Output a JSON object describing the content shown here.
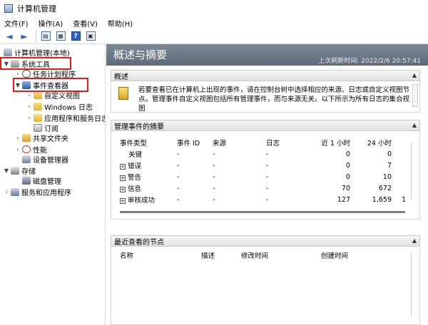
{
  "window": {
    "title": "计算机管理"
  },
  "menu": [
    "文件(F)",
    "操作(A)",
    "查看(V)",
    "帮助(H)"
  ],
  "toolbar": {
    "buttons": [
      {
        "icon": "back-arrow-icon",
        "glyph": "◄"
      },
      {
        "icon": "forward-arrow-icon",
        "glyph": "►"
      },
      {
        "icon": "console-tree-icon",
        "glyph": "▤"
      },
      {
        "icon": "show-hide-icon",
        "glyph": "▦"
      },
      {
        "icon": "help-icon",
        "glyph": "?"
      },
      {
        "icon": "properties-icon",
        "glyph": "▣"
      }
    ]
  },
  "tree": [
    {
      "label": "计算机管理(本地)"
    },
    {
      "label": "系统工具"
    },
    {
      "label": "任务计划程序"
    },
    {
      "label": "事件查看器"
    },
    {
      "label": "自定义视图"
    },
    {
      "label": "Windows 日志"
    },
    {
      "label": "应用程序和服务日志"
    },
    {
      "label": "订阅"
    },
    {
      "label": "共享文件夹"
    },
    {
      "label": "性能"
    },
    {
      "label": "设备管理器"
    },
    {
      "label": "存储"
    },
    {
      "label": "磁盘管理"
    },
    {
      "label": "服务和应用程序"
    }
  ],
  "header": {
    "title": "概述与摘要",
    "last_refresh": "上次刷新时间: 2022/2/6 20:57:41"
  },
  "overview": {
    "title": "概述",
    "text": "若要查看已在计算机上出现的事件，请在控制台树中选择相应的来源、日志或自定义视图节点。管理事件自定义视图包括所有管理事件，而与来源无关。以下所示为所有日志的集合视图"
  },
  "summary": {
    "title": "管理事件的摘要",
    "columns": [
      "事件类型",
      "事件 ID",
      "来源",
      "日志",
      "近 1 小时",
      "24 小时",
      ""
    ],
    "rows": [
      {
        "type": "关键",
        "expandable": false,
        "id": "-",
        "source": "-",
        "log": "-",
        "h1": "0",
        "h24": "0",
        "extra": ""
      },
      {
        "type": "错误",
        "expandable": true,
        "id": "-",
        "source": "-",
        "log": "-",
        "h1": "0",
        "h24": "7",
        "extra": ""
      },
      {
        "type": "警告",
        "expandable": true,
        "id": "-",
        "source": "-",
        "log": "-",
        "h1": "0",
        "h24": "10",
        "extra": ""
      },
      {
        "type": "信息",
        "expandable": true,
        "id": "-",
        "source": "-",
        "log": "-",
        "h1": "70",
        "h24": "672",
        "extra": ""
      },
      {
        "type": "审核成功",
        "expandable": true,
        "id": "-",
        "source": "-",
        "log": "-",
        "h1": "127",
        "h24": "1,659",
        "extra": "1"
      }
    ]
  },
  "recent": {
    "title": "最近查看的节点",
    "columns": [
      "名称",
      "描述",
      "修改时间",
      "创建时间"
    ]
  },
  "colors": {
    "highlight_box": "#e21b1b",
    "hero_bg": "#6c7884"
  }
}
